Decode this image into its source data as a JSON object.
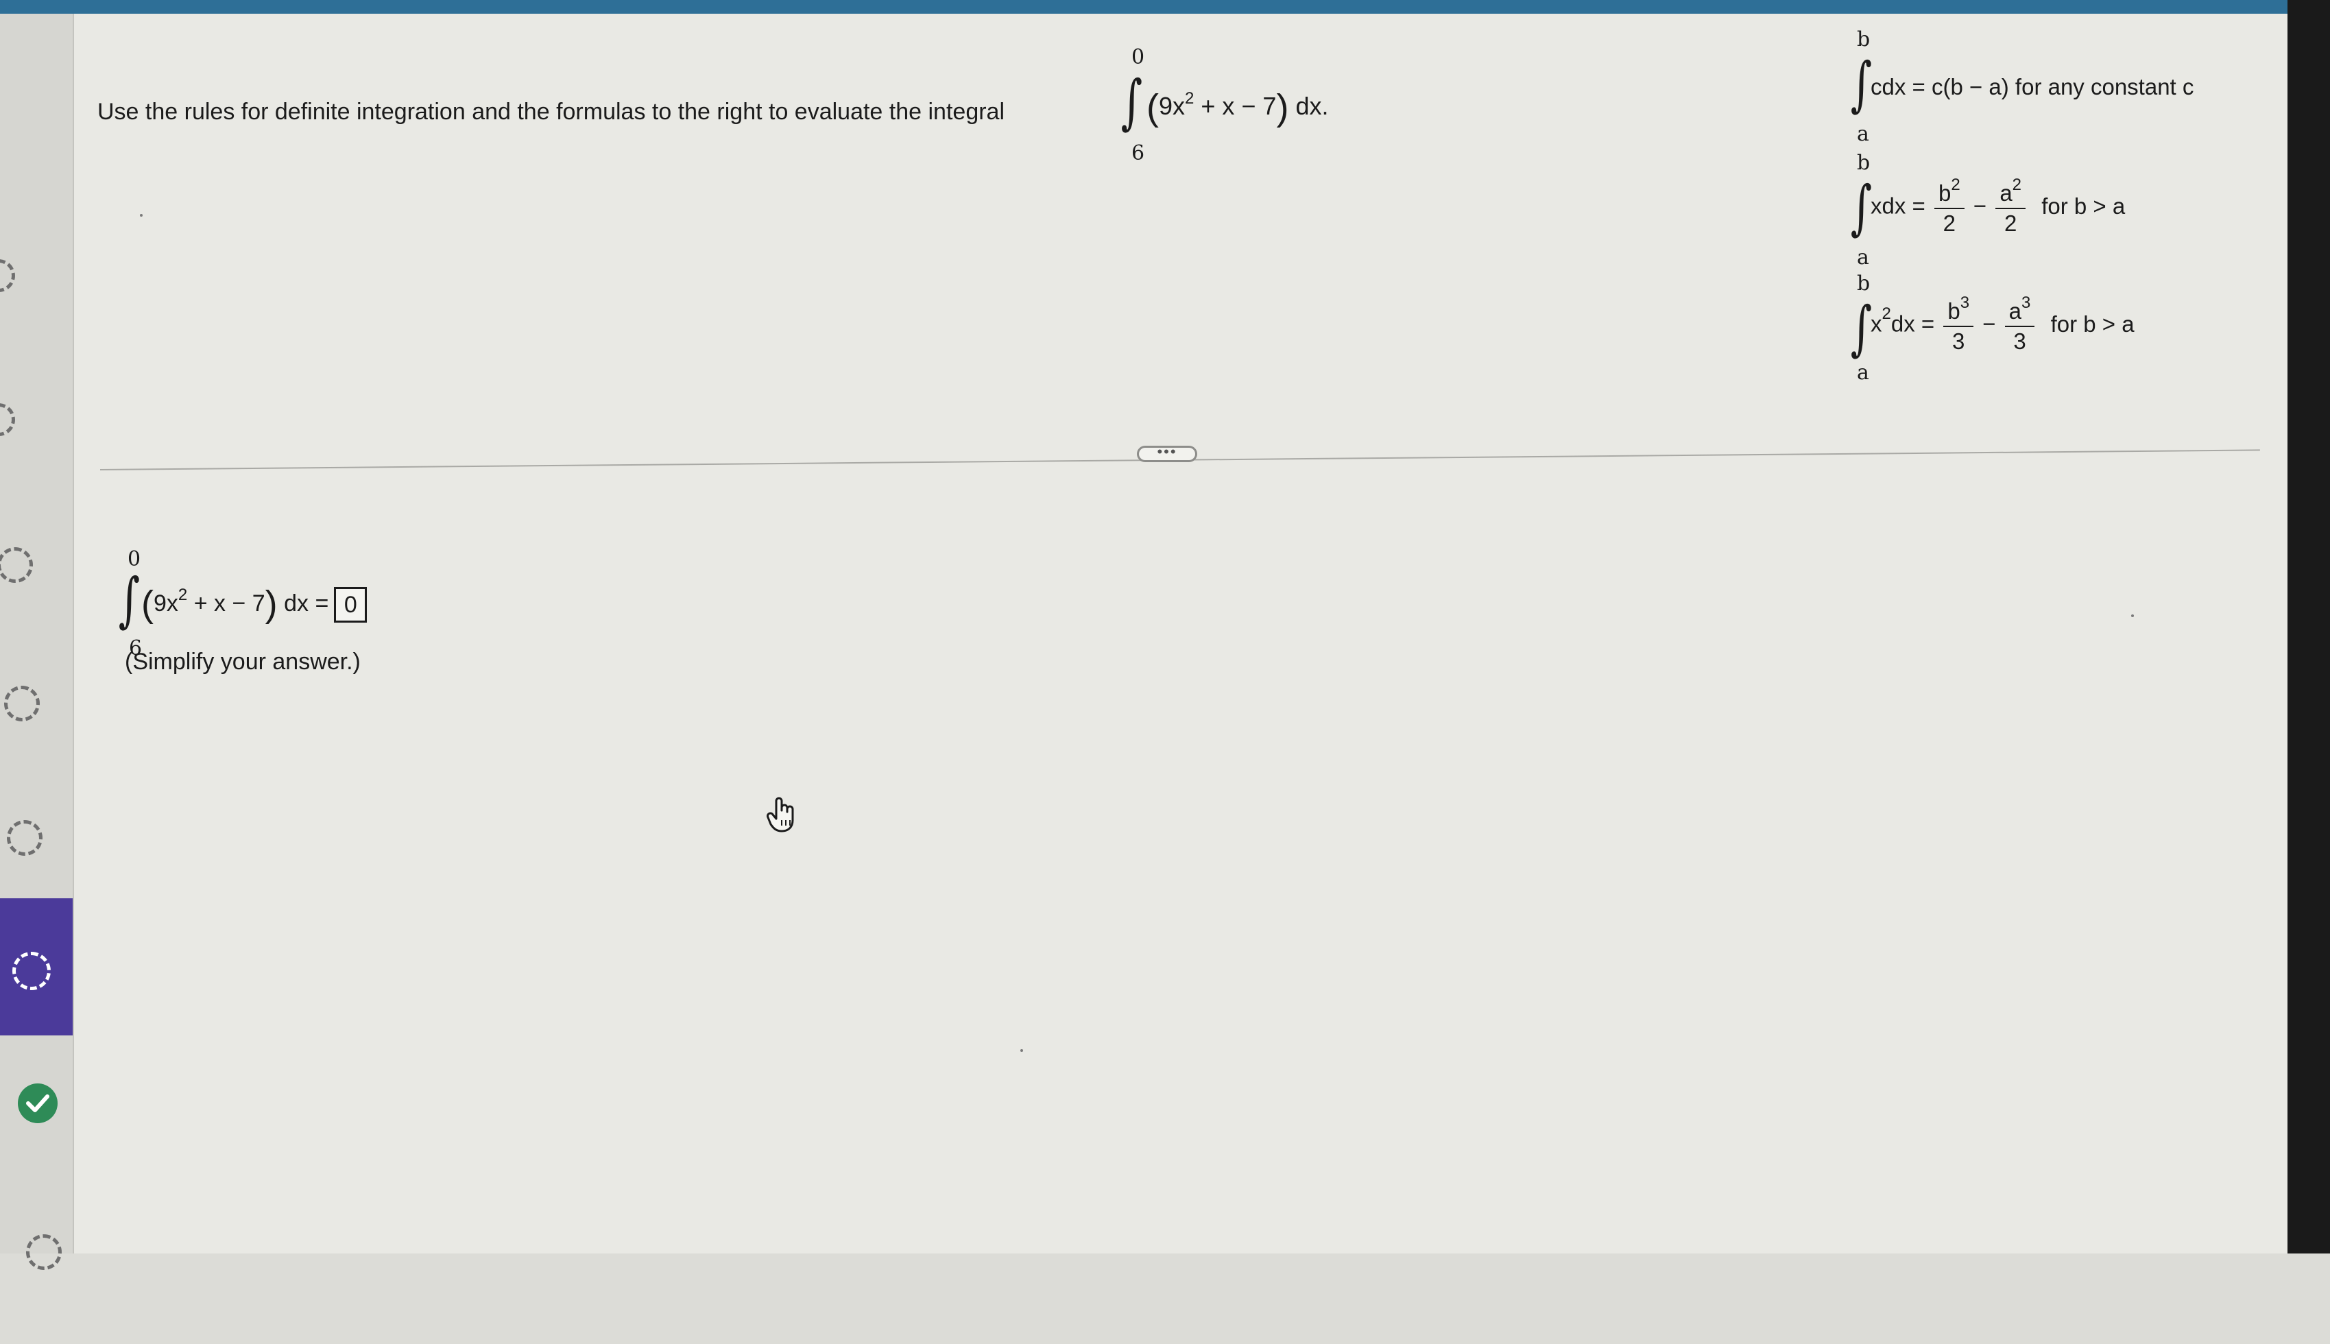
{
  "question": {
    "prompt": "Use the rules for definite integration and the formulas to the right to evaluate the integral",
    "integral": {
      "upper": "0",
      "lower": "6",
      "expression_open": "(",
      "expression_body": "9x",
      "exponent": "2",
      "expression_rest": " + x − 7",
      "expression_close": ")",
      "differential": " dx."
    }
  },
  "formulas": [
    {
      "upper": "b",
      "lower": "a",
      "lhs": "cdx = c(b − a) for any constant c"
    },
    {
      "upper": "b",
      "lower": "a",
      "lhs": "xdx =",
      "num1": "b",
      "exp1": "2",
      "den1": "2",
      "op": "−",
      "num2": "a",
      "exp2": "2",
      "den2": "2",
      "cond": "for b > a"
    },
    {
      "upper": "b",
      "lower": "a",
      "lhs_base": "x",
      "lhs_exp": "2",
      "lhs_rest": "dx =",
      "num1": "b",
      "exp1": "3",
      "den1": "3",
      "op": "−",
      "num2": "a",
      "exp2": "3",
      "den2": "3",
      "cond": "for b > a"
    }
  ],
  "more_button": "•••",
  "answer": {
    "upper": "0",
    "lower": "6",
    "expression_open": "(",
    "expression_body": "9x",
    "exponent": "2",
    "expression_rest": " + x − 7",
    "expression_close": ")",
    "differential": " dx =",
    "value": "0",
    "hint": "(Simplify your answer.)"
  },
  "sidebar": {
    "items": [
      {
        "status": "incomplete-icon"
      },
      {
        "status": "incomplete-icon"
      },
      {
        "status": "incomplete-icon"
      },
      {
        "status": "incomplete-icon"
      },
      {
        "status": "current-icon"
      },
      {
        "status": "check-icon",
        "color": "#2e8b57"
      },
      {
        "status": "incomplete-icon"
      }
    ],
    "active_color": "#4b3a9a"
  }
}
